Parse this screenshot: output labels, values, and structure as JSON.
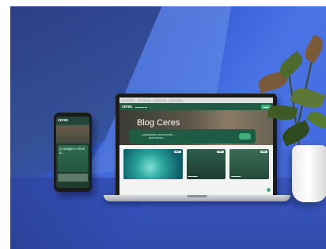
{
  "phone": {
    "logo": "ceres",
    "card_text": "Contagio e Direi à..."
  },
  "laptop": {
    "brand": "ceres",
    "hero_title": "Blog Ceres",
    "banner_text": "... participante permanente ... aprenderão ...",
    "banner_button": "..."
  }
}
